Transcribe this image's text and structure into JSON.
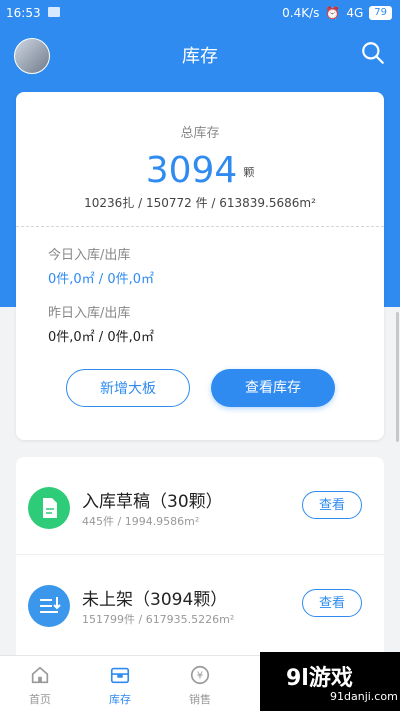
{
  "statusbar": {
    "time": "16:53",
    "network": "0.4K/s",
    "signal": "4G",
    "battery": "79"
  },
  "header": {
    "title": "库存"
  },
  "summary": {
    "label": "总库存",
    "count": "3094",
    "unit": "颗",
    "detail": "10236扎 / 150772 件 / 613839.5686m²",
    "today_label": "今日入库/出库",
    "today_value": "0件,0㎡ / 0件,0㎡",
    "yesterday_label": "昨日入库/出库",
    "yesterday_value": "0件,0㎡ / 0件,0㎡",
    "btn_add": "新增大板",
    "btn_view": "查看库存"
  },
  "list": [
    {
      "title": "入库草稿（30颗）",
      "meta": "445件 / 1994.9586m²",
      "button": "查看",
      "icon_color": "#2ecb78"
    },
    {
      "title": "未上架（3094颗）",
      "meta": "151799件 / 617935.5226m²",
      "button": "查看",
      "icon_color": "#3b97ec"
    }
  ],
  "tabs": [
    {
      "label": "首页",
      "icon": "home-icon"
    },
    {
      "label": "库存",
      "icon": "inventory-icon",
      "active": true
    },
    {
      "label": "销售",
      "icon": "yen-icon"
    }
  ],
  "watermark": {
    "brand": "9l游戏",
    "site": "91danji.com"
  },
  "colors": {
    "accent": "#2f8bf0",
    "green": "#2ecb78"
  }
}
